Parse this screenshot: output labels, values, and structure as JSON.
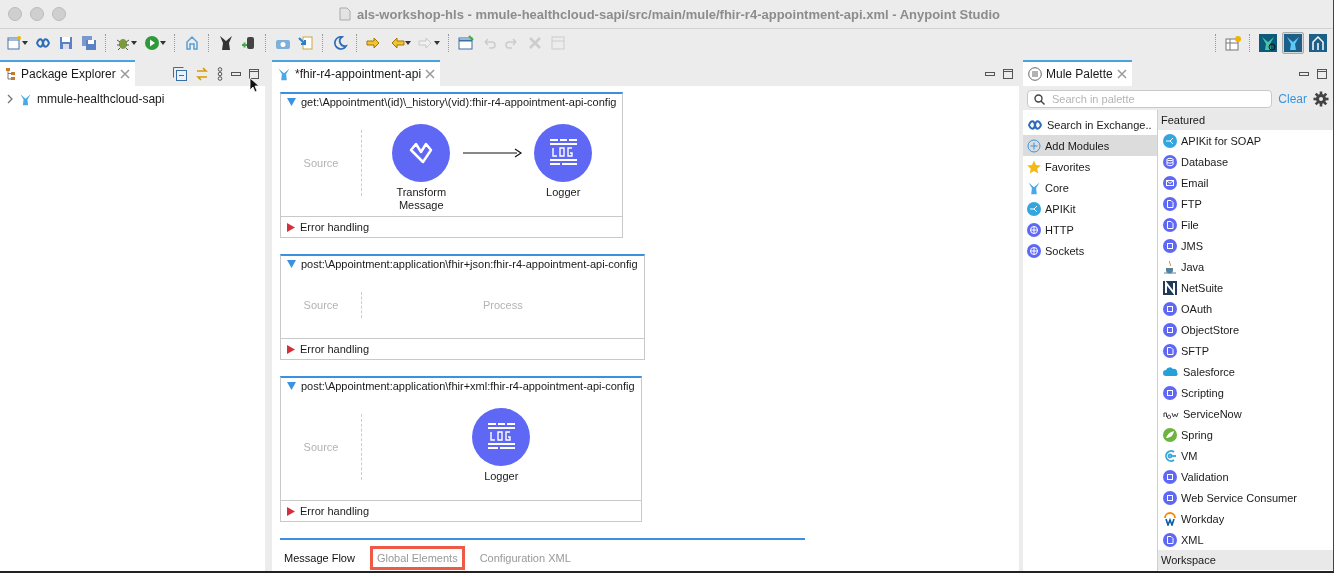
{
  "window": {
    "title": "als-workshop-hls - mmule-healthcloud-sapi/src/main/mule/fhir-r4-appointment-api.xml - Anypoint Studio"
  },
  "perspectives": [
    {
      "selected": false
    },
    {
      "selected": true
    },
    {
      "selected": false
    }
  ],
  "package_explorer": {
    "tab": "Package Explorer",
    "items": [
      {
        "label": "mmule-healthcloud-sapi",
        "expanded": false
      }
    ]
  },
  "editor": {
    "tab": "*fhir-r4-appointment-api",
    "flows": [
      {
        "kind": "flow",
        "title": "get:\\Appointment\\(id)\\_history\\(vid):fhir-r4-appointment-api-config",
        "expanded": true,
        "source": "Source",
        "components": [
          {
            "kind": "transform",
            "label": "Transform Message"
          },
          {
            "kind": "logger",
            "label": "Logger"
          }
        ],
        "error_handling": {
          "label": "Error handling",
          "expanded": false
        }
      },
      {
        "kind": "flow",
        "title": "post:\\Appointment:application\\fhir+json:fhir-r4-appointment-api-config",
        "expanded": true,
        "source": "Source",
        "placeholder": "Process",
        "error_handling": {
          "label": "Error handling",
          "expanded": false
        }
      },
      {
        "kind": "flow",
        "title": "post:\\Appointment:application\\fhir+xml:fhir-r4-appointment-api-config",
        "expanded": true,
        "source": "Source",
        "components": [
          {
            "kind": "logger",
            "label": "Logger"
          }
        ],
        "error_handling": {
          "label": "Error handling",
          "expanded": false
        }
      },
      {
        "kind": "edge"
      }
    ],
    "bottom_tabs": [
      {
        "label": "Message Flow",
        "selected": true,
        "highlighted": false
      },
      {
        "label": "Global Elements",
        "selected": false,
        "highlighted": true
      },
      {
        "label": "Configuration XML",
        "selected": false,
        "highlighted": false
      }
    ]
  },
  "palette": {
    "tab": "Mule Palette",
    "search": {
      "placeholder": "Search in palette"
    },
    "clear": "Clear",
    "categories": [
      {
        "label": "Search in Exchange..",
        "selected": false
      },
      {
        "label": "Add Modules",
        "selected": true
      },
      {
        "label": "Favorites",
        "selected": false
      },
      {
        "label": "Core",
        "selected": false
      },
      {
        "label": "APIKit",
        "selected": false
      },
      {
        "label": "HTTP",
        "selected": false
      },
      {
        "label": "Sockets",
        "selected": false
      }
    ],
    "featured": "Featured",
    "items": [
      "APIKit for SOAP",
      "Database",
      "Email",
      "FTP",
      "File",
      "JMS",
      "Java",
      "NetSuite",
      "OAuth",
      "ObjectStore",
      "SFTP",
      "Salesforce",
      "Scripting",
      "ServiceNow",
      "Spring",
      "VM",
      "Validation",
      "Web Service Consumer",
      "Workday",
      "XML"
    ],
    "workspace": "Workspace"
  }
}
